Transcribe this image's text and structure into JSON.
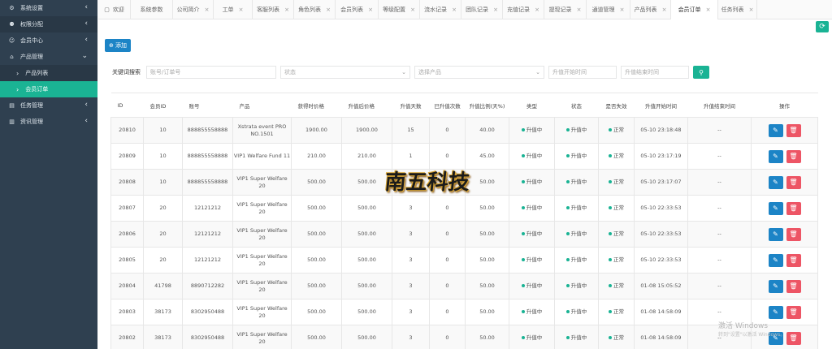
{
  "sidebar": {
    "items": [
      {
        "label": "系统设置",
        "icon": "gear-icon",
        "glyph": "⚙",
        "chev": "‹"
      },
      {
        "label": "权限分配",
        "icon": "user-lock-icon",
        "glyph": "⚉",
        "chev": "‹"
      },
      {
        "label": "会员中心",
        "icon": "user-icon",
        "glyph": "☺",
        "chev": "‹"
      },
      {
        "label": "产品管理",
        "icon": "shop-icon",
        "glyph": "⌂",
        "chev": "⌄"
      }
    ],
    "sub_items": [
      {
        "label": "产品列表",
        "glyph": "›"
      },
      {
        "label": "会员订单",
        "glyph": "›"
      }
    ],
    "tail_items": [
      {
        "label": "任务管理",
        "icon": "task-icon",
        "glyph": "▤",
        "chev": "‹"
      },
      {
        "label": "资讯管理",
        "icon": "news-icon",
        "glyph": "▥",
        "chev": "‹"
      }
    ]
  },
  "tabs": [
    {
      "label": "欢迎",
      "close": ""
    },
    {
      "label": "系统参数",
      "close": ""
    },
    {
      "label": "公司简介",
      "close": "×"
    },
    {
      "label": "工单",
      "close": "×"
    },
    {
      "label": "客服列表",
      "close": "×"
    },
    {
      "label": "角色列表",
      "close": "×"
    },
    {
      "label": "会员列表",
      "close": "×"
    },
    {
      "label": "等级配置",
      "close": "×"
    },
    {
      "label": "流水记录",
      "close": "×"
    },
    {
      "label": "团队记录",
      "close": "×"
    },
    {
      "label": "充值记录",
      "close": "×"
    },
    {
      "label": "提现记录",
      "close": "×"
    },
    {
      "label": "通道管理",
      "close": "×"
    },
    {
      "label": "产品列表",
      "close": "×"
    },
    {
      "label": "会员订单",
      "close": "×"
    },
    {
      "label": "任务列表",
      "close": "×"
    }
  ],
  "toolbar": {
    "add_label": "⊕ 添加"
  },
  "search": {
    "label": "关键词搜索",
    "account_placeholder": "账号/订单号",
    "status_placeholder": "状态",
    "product_placeholder": "选择产品",
    "start_placeholder": "升值开始时间",
    "end_placeholder": "升值结束时间",
    "search_glyph": "⚲"
  },
  "table": {
    "columns": [
      "ID",
      "会员ID",
      "账号",
      "产品",
      "获得时价格",
      "升值后价格",
      "升值天数",
      "已升值次数",
      "升值比例(天%)",
      "类型",
      "状态",
      "是否失效",
      "升值开始时间",
      "升值结束时间",
      "操作"
    ],
    "rows": [
      [
        "20810",
        "10",
        "888855558888",
        "Xstrata event PRO NO.1501",
        "1900.00",
        "1900.00",
        "15",
        "0",
        "40.00",
        "升值中",
        "升值中",
        "正常",
        "05-10 23:18:48",
        "--"
      ],
      [
        "20809",
        "10",
        "888855558888",
        "VIP1 Welfare Fund 11",
        "210.00",
        "210.00",
        "1",
        "0",
        "45.00",
        "升值中",
        "升值中",
        "正常",
        "05-10 23:17:19",
        "--"
      ],
      [
        "20808",
        "10",
        "888855558888",
        "VIP1 Super Welfare 20",
        "500.00",
        "500.00",
        "3",
        "0",
        "50.00",
        "升值中",
        "升值中",
        "正常",
        "05-10 23:17:07",
        "--"
      ],
      [
        "20807",
        "20",
        "12121212",
        "VIP1 Super Welfare 20",
        "500.00",
        "500.00",
        "3",
        "0",
        "50.00",
        "升值中",
        "升值中",
        "正常",
        "05-10 22:33:53",
        "--"
      ],
      [
        "20806",
        "20",
        "12121212",
        "VIP1 Super Welfare 20",
        "500.00",
        "500.00",
        "3",
        "0",
        "50.00",
        "升值中",
        "升值中",
        "正常",
        "05-10 22:33:53",
        "--"
      ],
      [
        "20805",
        "20",
        "12121212",
        "VIP1 Super Welfare 20",
        "500.00",
        "500.00",
        "3",
        "0",
        "50.00",
        "升值中",
        "升值中",
        "正常",
        "05-10 22:33:53",
        "--"
      ],
      [
        "20804",
        "41798",
        "8890712282",
        "VIP1 Super Welfare 20",
        "500.00",
        "500.00",
        "3",
        "0",
        "50.00",
        "升值中",
        "升值中",
        "正常",
        "01-08 15:05:52",
        "--"
      ],
      [
        "20803",
        "38173",
        "8302950488",
        "VIP1 Super Welfare 20",
        "500.00",
        "500.00",
        "3",
        "0",
        "50.00",
        "升值中",
        "升值中",
        "正常",
        "01-08 14:58:09",
        "--"
      ],
      [
        "20802",
        "38173",
        "8302950488",
        "VIP1 Super Welfare 20",
        "500.00",
        "500.00",
        "3",
        "0",
        "50.00",
        "升值中",
        "升值中",
        "正常",
        "01-08 14:58:09",
        "--"
      ]
    ]
  },
  "watermark": {
    "text": "南五科技"
  },
  "windows_activation": {
    "title": "激活 Windows",
    "sub": "转到\"设置\"以激活 Windows。"
  },
  "colors": {
    "sidebar": "#2f4050",
    "accent": "#1ab394",
    "primary": "#1c84c6",
    "danger": "#ed5565"
  }
}
